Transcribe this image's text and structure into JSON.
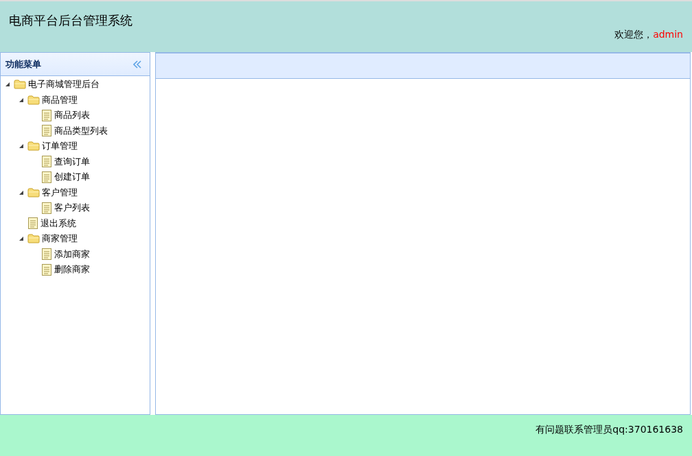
{
  "header": {
    "title": "电商平台后台管理系统",
    "greeting": "欢迎您，",
    "user": "admin"
  },
  "sidebar": {
    "title": "功能菜单",
    "tree": [
      {
        "label": "电子商城管理后台",
        "kind": "folder",
        "expanded": true,
        "children": [
          {
            "label": "商品管理",
            "kind": "folder",
            "expanded": true,
            "children": [
              {
                "label": "商品列表",
                "kind": "file"
              },
              {
                "label": "商品类型列表",
                "kind": "file"
              }
            ]
          },
          {
            "label": "订单管理",
            "kind": "folder",
            "expanded": true,
            "children": [
              {
                "label": "查询订单",
                "kind": "file"
              },
              {
                "label": "创建订单",
                "kind": "file"
              }
            ]
          },
          {
            "label": "客户管理",
            "kind": "folder",
            "expanded": true,
            "children": [
              {
                "label": "客户列表",
                "kind": "file"
              }
            ]
          },
          {
            "label": "退出系统",
            "kind": "file"
          },
          {
            "label": "商家管理",
            "kind": "folder",
            "expanded": true,
            "children": [
              {
                "label": "添加商家",
                "kind": "file"
              },
              {
                "label": "删除商家",
                "kind": "file"
              }
            ]
          }
        ]
      }
    ]
  },
  "footer": {
    "text": "有问题联系管理员qq:370161638"
  }
}
